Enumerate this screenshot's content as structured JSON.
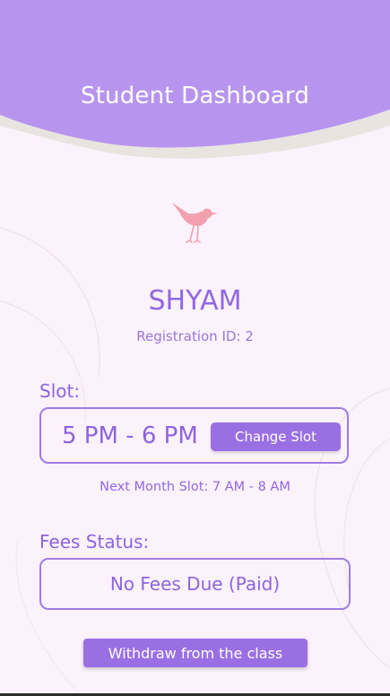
{
  "header": {
    "title": "Student Dashboard"
  },
  "logo": {
    "icon": "bird-icon",
    "color": "#f2a0ae"
  },
  "student": {
    "name": "SHYAM",
    "registration": "Registration ID: 2"
  },
  "slot": {
    "label": "Slot:",
    "current": "5 PM - 6 PM",
    "change_button": "Change Slot",
    "next_month": "Next Month Slot: 7 AM - 8 AM"
  },
  "fees": {
    "label": "Fees Status:",
    "status": "No Fees Due (Paid)"
  },
  "actions": {
    "withdraw_button": "Withdraw from the class"
  },
  "colors": {
    "accent": "#9b6fe4",
    "header": "#b795ef",
    "background": "#fcf2fc"
  }
}
